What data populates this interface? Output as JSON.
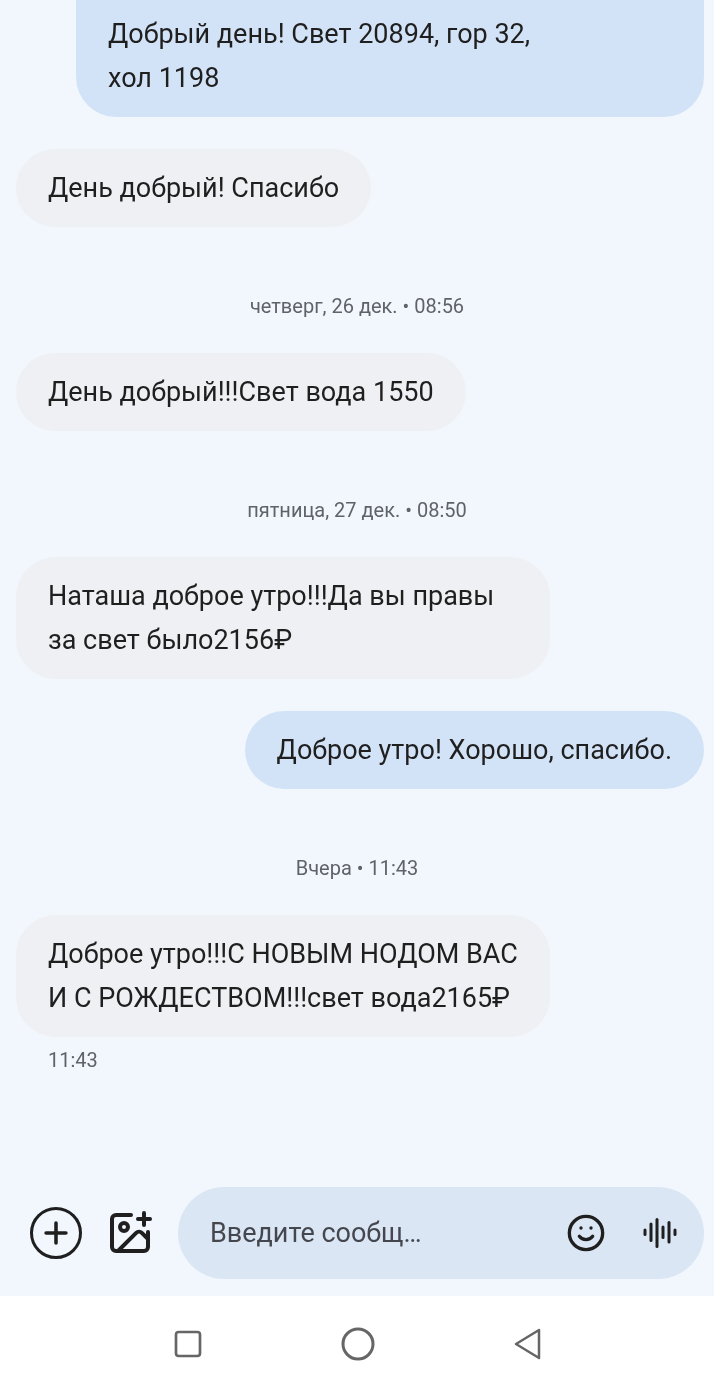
{
  "messages": [
    {
      "kind": "sent",
      "text": "Добрый день! Свет 20894, гор 32, хол 1198"
    },
    {
      "kind": "received",
      "text": "День добрый! Спасибо"
    },
    {
      "kind": "date",
      "text": "четверг, 26 дек. • 08:56"
    },
    {
      "kind": "received",
      "text": "День добрый!!!Свет вода 1550"
    },
    {
      "kind": "date",
      "text": "пятница, 27 дек. • 08:50"
    },
    {
      "kind": "received",
      "text": "Наташа доброе утро!!!Да вы правы за свет было2156₽"
    },
    {
      "kind": "sent",
      "text": "Доброе утро! Хорошо, спасибо."
    },
    {
      "kind": "date",
      "text": "Вчера • 11:43"
    },
    {
      "kind": "received",
      "text": "Доброе утро!!!С НОВЫМ НОДОМ ВАС И С РОЖДЕСТВОМ!!!свет вода2165₽"
    },
    {
      "kind": "time",
      "text": "11:43"
    }
  ],
  "composer": {
    "placeholder": "Введите сообщ…"
  }
}
